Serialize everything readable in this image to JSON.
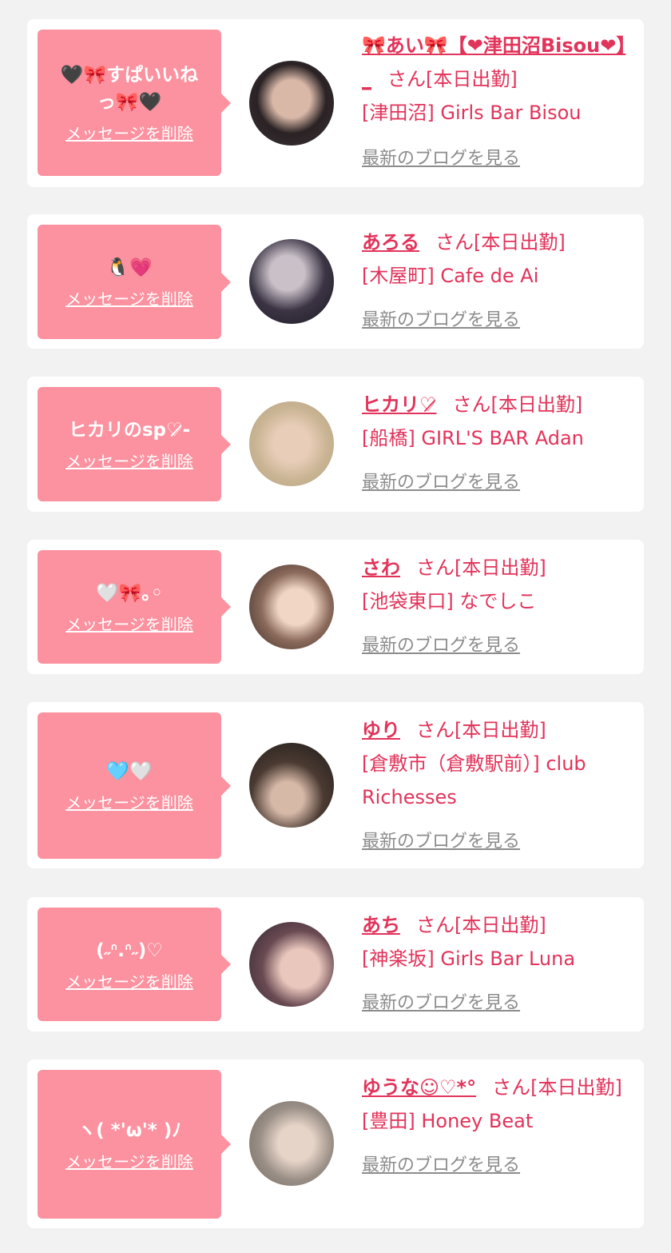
{
  "delete_label": "メッセージを削除",
  "blog_label": "最新のブログを見る",
  "san_label": "さん",
  "cards": [
    {
      "message": "🖤🎀すぱいいね\nっ🎀🖤",
      "name": "🎀あい🎀【❤津田沼Bisou❤】_",
      "status": "[本日出勤]",
      "shop": "[津田沼] Girls Bar Bisou"
    },
    {
      "message": "🐧💗",
      "name": "あろる",
      "status": "[本日出勤]",
      "shop": "[木屋町] Cafe de Ai"
    },
    {
      "message": "ヒカリのsp♡̷̷-",
      "name": "ヒカリ♡̷",
      "status": "[本日出勤]",
      "shop": "[船橋] GIRL'S BAR Adan"
    },
    {
      "message": "🤍🎀｡◦",
      "name": "さわ",
      "status": "[本日出勤]",
      "shop": "[池袋東口] なでしこ"
    },
    {
      "message": "🩵🤍",
      "name": "ゆり",
      "status": "[本日出勤]",
      "shop": "[倉敷市（倉敷駅前）] club Richesses"
    },
    {
      "message": "(˶ᐢ.ᐢ˶)♡",
      "name": "あち",
      "status": "[本日出勤]",
      "shop": "[神楽坂] Girls Bar Luna"
    },
    {
      "message": "ヽ( *'ω'* )ﾉ",
      "name": "ゆうな☺︎♡*°",
      "status": "[本日出勤]",
      "shop": "[豊田] Honey Beat"
    }
  ]
}
